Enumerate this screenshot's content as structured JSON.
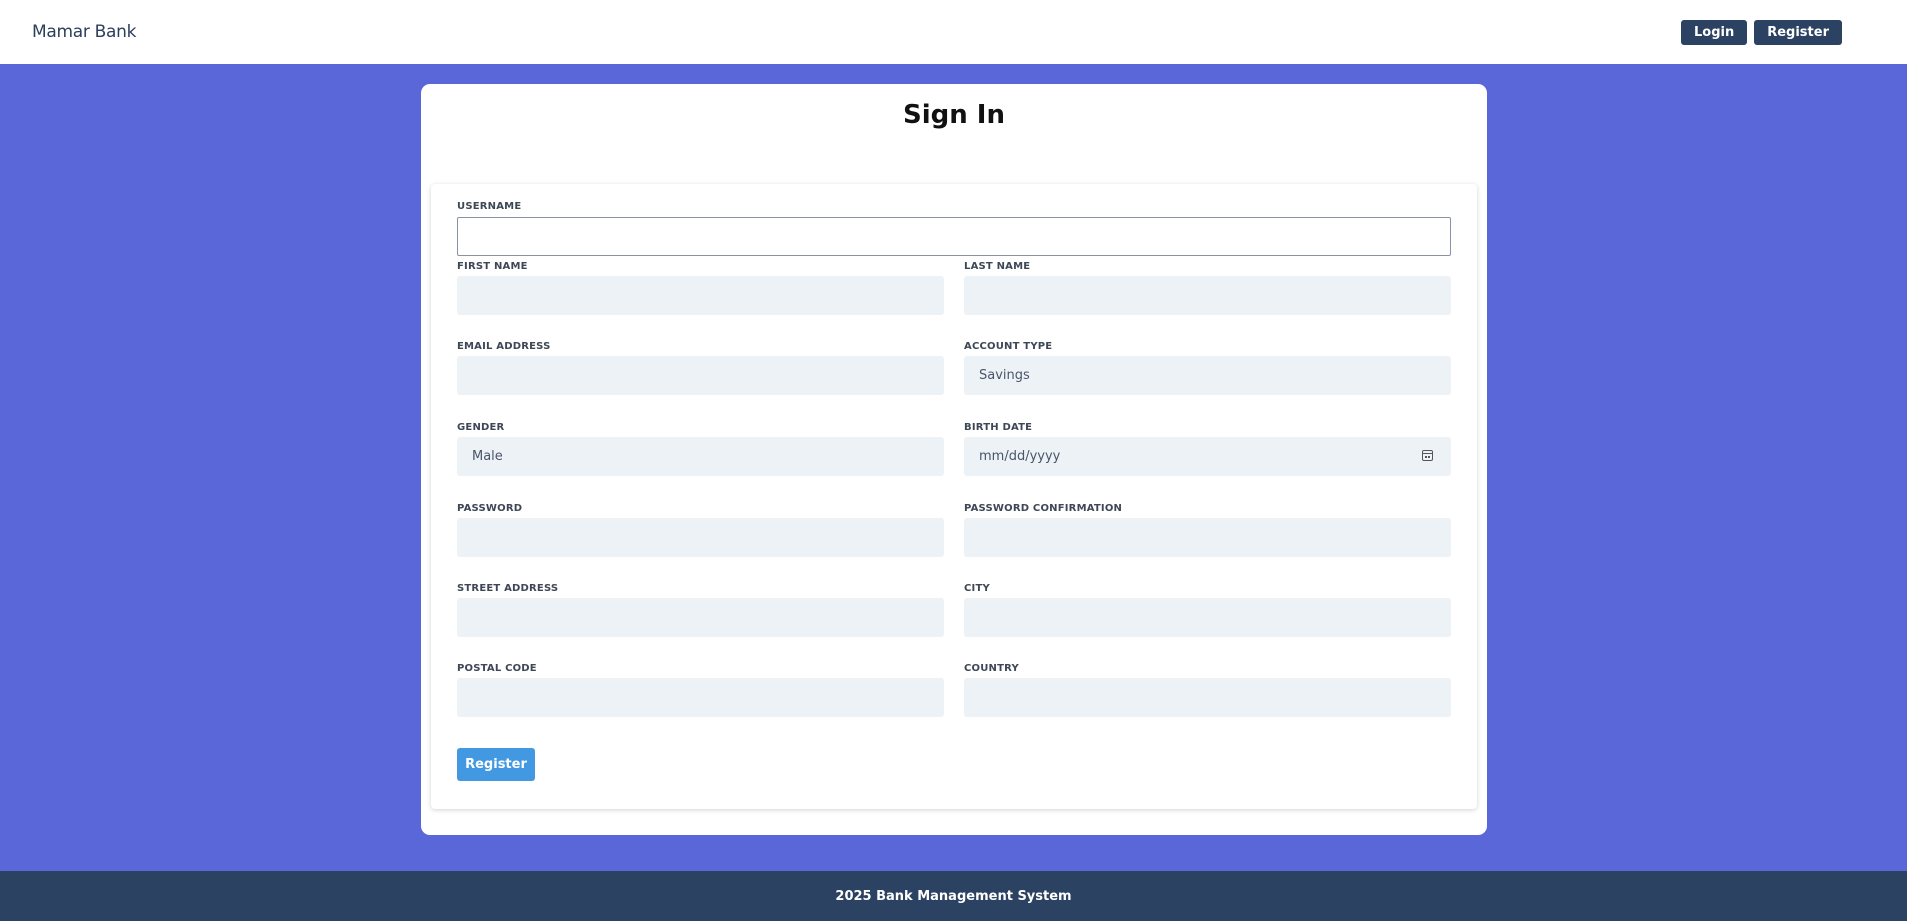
{
  "navbar": {
    "brand": "Mamar Bank",
    "login_label": "Login",
    "register_label": "Register"
  },
  "form": {
    "title": "Sign In",
    "fields": {
      "username": {
        "label": "USERNAME",
        "value": ""
      },
      "first_name": {
        "label": "FIRST NAME",
        "value": ""
      },
      "last_name": {
        "label": "LAST NAME",
        "value": ""
      },
      "email": {
        "label": "EMAIL ADDRESS",
        "value": ""
      },
      "account_type": {
        "label": "ACCOUNT TYPE",
        "value": "Savings"
      },
      "gender": {
        "label": "GENDER",
        "value": "Male"
      },
      "birth_date": {
        "label": "BIRTH DATE",
        "placeholder": "mm/dd/yyyy"
      },
      "password": {
        "label": "PASSWORD",
        "value": ""
      },
      "password_confirmation": {
        "label": "PASSWORD CONFIRMATION",
        "value": ""
      },
      "street_address": {
        "label": "STREET ADDRESS",
        "value": ""
      },
      "city": {
        "label": "CITY",
        "value": ""
      },
      "postal_code": {
        "label": "POSTAL CODE",
        "value": ""
      },
      "country": {
        "label": "COUNTRY",
        "value": ""
      }
    },
    "submit_label": "Register"
  },
  "footer": {
    "text": "2025 Bank Management System"
  },
  "colors": {
    "page_background": "#5a67d8",
    "navbar_button": "#2c4263",
    "footer": "#2c4263",
    "input_background": "#edf2f7",
    "primary_button": "#4299e1"
  }
}
